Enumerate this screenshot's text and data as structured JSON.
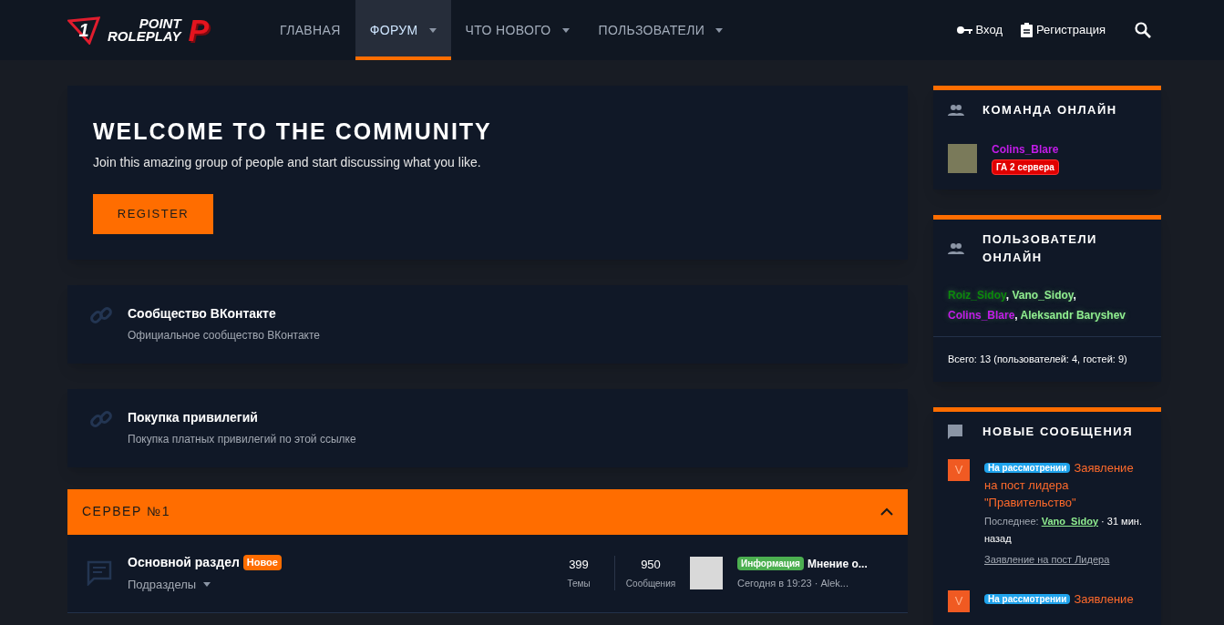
{
  "logo": {
    "number": "1",
    "line1": "POINT",
    "line2": "ROLEPLAY",
    "letter": "P"
  },
  "nav": [
    {
      "label": "ГЛАВНАЯ",
      "selected": false,
      "has_menu": false
    },
    {
      "label": "ФОРУМ",
      "selected": true,
      "has_menu": true
    },
    {
      "label": "ЧТО НОВОГО",
      "selected": false,
      "has_menu": true
    },
    {
      "label": "ПОЛЬЗОВАТЕЛИ",
      "selected": false,
      "has_menu": true
    }
  ],
  "account": {
    "login": "Вход",
    "register": "Регистрация"
  },
  "welcome": {
    "title": "WELCOME TO THE COMMUNITY",
    "text": "Join this amazing group of people and start discussing what you like.",
    "button": "REGISTER"
  },
  "links": [
    {
      "title": "Сообщество ВКонтакте",
      "description": "Официальное сообщество ВКонтакте"
    },
    {
      "title": "Покупка привилегий",
      "description": "Покупка платных привилегий по этой ссылке"
    }
  ],
  "category": {
    "title": "СЕРВЕР №1",
    "expanded": true,
    "forums": [
      {
        "title": "Основной раздел",
        "badge": "Новое",
        "subforums": "Подразделы",
        "threads": "399",
        "threads_label": "Темы",
        "messages": "950",
        "messages_label": "Сообщения",
        "last_prefix": "Информация",
        "last_title": "Мнение о...",
        "last_meta": "Сегодня в 19:23 · Alek..."
      }
    ]
  },
  "staff_online": {
    "title": "КОМАНДА ОНЛАЙН",
    "members": [
      {
        "name": "Colins_Blare",
        "color": "#c21ce8",
        "role": "ГА 2 сервера"
      }
    ]
  },
  "users_online": {
    "title": "ПОЛЬЗОВАТЕЛИ ОНЛАЙН",
    "separator": ",",
    "users": [
      {
        "name": "Roiz_Sidoy",
        "color": "#0b8a0b"
      },
      {
        "name": "Vano_Sidoy",
        "color": "#90ee90"
      },
      {
        "name": "Colins_Blare",
        "color": "#c21ce8"
      },
      {
        "name": "Aleksandr Baryshev",
        "color": "#90ee90"
      }
    ],
    "total": "Всего: 13 (пользователей: 4, гостей: 9)"
  },
  "new_posts": {
    "title": "НОВЫЕ СООБЩЕНИЯ",
    "posts": [
      {
        "avatar_letter": "V",
        "prefix": "На рассмотрении",
        "title": "Заявление на пост лидера \"Правительство\"",
        "last_label": "Последнее:",
        "last_user": "Vano_Sidoy",
        "time": "· 31 мин. назад",
        "forum": "Заявление на пост Лидера"
      },
      {
        "avatar_letter": "V",
        "prefix": "На рассмотрении",
        "title": "Заявление"
      }
    ]
  }
}
